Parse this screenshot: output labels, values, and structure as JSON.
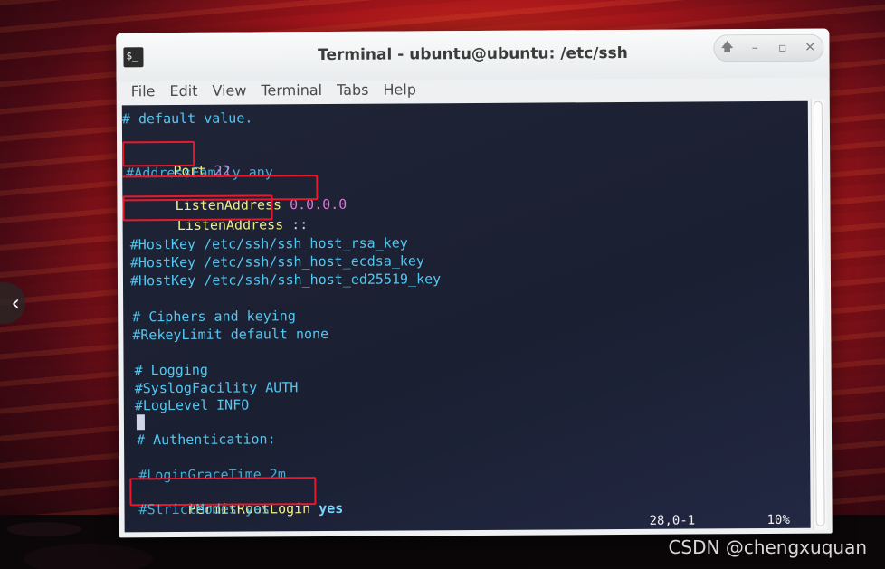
{
  "window": {
    "title": "Terminal - ubuntu@ubuntu: /etc/ssh",
    "app_icon_text": "$_",
    "buttons": {
      "up": "🡅",
      "minimize": "–",
      "maximize": "▫",
      "close": "✕"
    }
  },
  "menu": [
    "File",
    "Edit",
    "View",
    "Terminal",
    "Tabs",
    "Help"
  ],
  "terminal": {
    "lines": [
      {
        "text": "# default value.",
        "style": "cmt"
      },
      {
        "key": "Port",
        "value": "22",
        "highlight": true
      },
      {
        "text": "#AddressFamily any",
        "style": "cmt"
      },
      {
        "key": "ListenAddress",
        "value": "0.0.0.0",
        "highlight": true
      },
      {
        "key": "ListenAddress",
        "value": "::",
        "highlight": true
      },
      {
        "text": "#HostKey /etc/ssh/ssh_host_rsa_key",
        "style": "cmt"
      },
      {
        "text": "#HostKey /etc/ssh/ssh_host_ecdsa_key",
        "style": "cmt"
      },
      {
        "text": "#HostKey /etc/ssh/ssh_host_ed25519_key",
        "style": "cmt"
      },
      {
        "text": "# Ciphers and keying",
        "style": "cmt"
      },
      {
        "text": "#RekeyLimit default none",
        "style": "cmt"
      },
      {
        "text": "# Logging",
        "style": "cmt"
      },
      {
        "text": "#SyslogFacility AUTH",
        "style": "cmt"
      },
      {
        "text": "#LogLevel INFO",
        "style": "cmt"
      },
      {
        "text": "# Authentication:",
        "style": "cmt"
      },
      {
        "text": "#LoginGraceTime 2m",
        "style": "cmt"
      },
      {
        "key": "PermitRootLogin",
        "value": "yes",
        "highlight": true
      },
      {
        "text": "#StrictModes yes",
        "style": "cmt"
      }
    ],
    "status": {
      "position": "28,0-1",
      "percent": "10%"
    }
  },
  "overlay": {
    "nav_arrow": "‹",
    "watermark": "CSDN @chengxuquan"
  },
  "colors": {
    "comment": "#52c7f2",
    "keyword": "#f3ec85",
    "number": "#d778d6",
    "highlight_box": "#e8192c"
  }
}
